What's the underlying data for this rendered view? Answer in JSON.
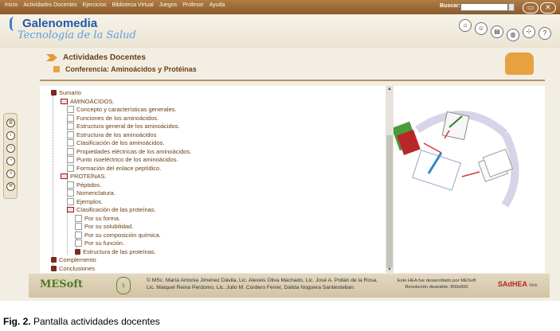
{
  "menu": [
    "Inicio",
    "Actividades Docentes",
    "Ejercicios",
    "Biblioteca Virtual",
    "Juegos",
    "Profesor",
    "Ayuda"
  ],
  "search": {
    "label": "Buscar:",
    "value": ""
  },
  "window": {
    "restore_icon": "restore-icon",
    "close_icon": "close-icon"
  },
  "brand": {
    "name": "Galenomedia",
    "tagline": "Tecnología de la Salud"
  },
  "header_icons": [
    "home-icon",
    "people-icon",
    "document-icon",
    "globe-icon",
    "network-icon",
    "help-icon"
  ],
  "titles": {
    "section": "Actividades Docentes",
    "subtitle": "Conferencia: Aminoácidos y Protéinas"
  },
  "tree": [
    {
      "label": "Sumario",
      "level": 0,
      "icon": "book"
    },
    {
      "label": "AMINOÁCIDOS.",
      "level": 1,
      "icon": "folder"
    },
    {
      "label": "Concepto y características generales.",
      "level": 2,
      "icon": "doc"
    },
    {
      "label": "Funciones de los aminoácidos.",
      "level": 2,
      "icon": "doc"
    },
    {
      "label": "Estructura general de los aminoácidos.",
      "level": 2,
      "icon": "doc"
    },
    {
      "label": "Estructura de los aminoácidos",
      "level": 2,
      "icon": "doc"
    },
    {
      "label": "Clasificación de los aminoácidos.",
      "level": 2,
      "icon": "doc"
    },
    {
      "label": "Propiedades eléctricas de los aminoácidos.",
      "level": 2,
      "icon": "doc"
    },
    {
      "label": "Punto isoeléctrico de los aminoácidos.",
      "level": 2,
      "icon": "doc"
    },
    {
      "label": "Formación del enlace peptídico.",
      "level": 2,
      "icon": "doc"
    },
    {
      "label": "PROTEÍNAS.",
      "level": 1,
      "icon": "folder"
    },
    {
      "label": "Péptidos.",
      "level": 2,
      "icon": "doc"
    },
    {
      "label": "Nomenclatura.",
      "level": 2,
      "icon": "doc"
    },
    {
      "label": "Ejemplos.",
      "level": 2,
      "icon": "doc"
    },
    {
      "label": "Clasificación de las proteínas.",
      "level": 2,
      "icon": "folder"
    },
    {
      "label": "Por su forma.",
      "level": 3,
      "icon": "doc"
    },
    {
      "label": "Por su solubilidad.",
      "level": 3,
      "icon": "doc"
    },
    {
      "label": "Por su composición química.",
      "level": 3,
      "icon": "doc"
    },
    {
      "label": "Por su función.",
      "level": 3,
      "icon": "doc"
    },
    {
      "label": "Estructura de las proteínas.",
      "level": 3,
      "icon": "book"
    },
    {
      "label": "Complemento",
      "level": 0,
      "icon": "book"
    },
    {
      "label": "Conclusiones",
      "level": 0,
      "icon": "book"
    }
  ],
  "side_icons": [
    "chart-icon",
    "info-icon",
    "smile-icon",
    "clock-icon",
    "list-icon",
    "tool-icon"
  ],
  "footer": {
    "logo": "MESoft",
    "credits": "© MSc. María Antonia Jiménez Dávila, Lic. Alexeis Oliva Machado, Lic. José A. Pollán de la Rosa, Lic. Maiquel Reina Perdomo, Lic. Julio M. Cordero Ferrer, Dalida Noguera Santiesteban.",
    "note": "Este HEA fue desarrollado por MESoft Resolución deseable: 800x600",
    "brand": "SAdHEA",
    "brand_suffix": "Web"
  },
  "caption": {
    "label": "Fig. 2.",
    "text": " Pantalla actividades docentes"
  },
  "colors": {
    "menubar": "#9c6a36",
    "accent": "#e8a44a",
    "text": "#6a3e12",
    "brand": "#1f5aa8"
  }
}
